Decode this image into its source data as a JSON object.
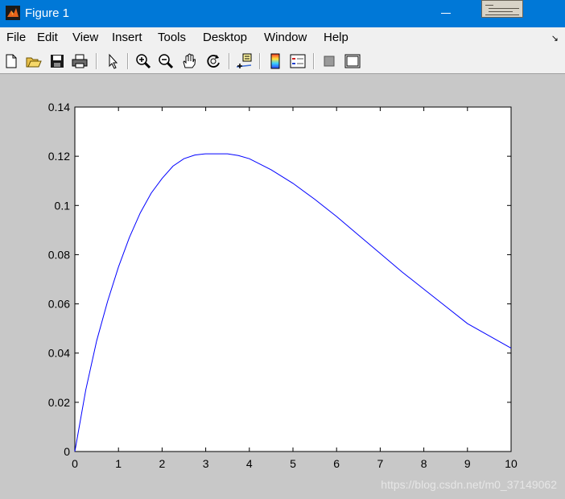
{
  "window": {
    "title": "Figure 1"
  },
  "menu": {
    "file": "File",
    "edit": "Edit",
    "view": "View",
    "insert": "Insert",
    "tools": "Tools",
    "desktop": "Desktop",
    "window": "Window",
    "help": "Help"
  },
  "toolbar": {
    "buttons": [
      "new-figure-icon",
      "open-file-icon",
      "save-icon",
      "print-icon",
      "edit-plot-icon",
      "zoom-in-icon",
      "zoom-out-icon",
      "pan-icon",
      "rotate-3d-icon",
      "data-cursor-icon",
      "colorbar-icon",
      "legend-icon",
      "hide-plot-tools-icon",
      "show-plot-tools-icon"
    ]
  },
  "watermark": "https://blog.csdn.net/m0_37149062",
  "chart_data": {
    "type": "line",
    "x": [
      0,
      0.25,
      0.5,
      0.75,
      1,
      1.25,
      1.5,
      1.75,
      2,
      2.25,
      2.5,
      2.75,
      3,
      3.25,
      3.5,
      3.75,
      4,
      4.5,
      5,
      5.5,
      6,
      6.5,
      7,
      7.5,
      8,
      8.5,
      9,
      9.5,
      10
    ],
    "series": [
      {
        "values": [
          0,
          0.025,
          0.045,
          0.061,
          0.075,
          0.087,
          0.097,
          0.105,
          0.111,
          0.116,
          0.119,
          0.1205,
          0.121,
          0.121,
          0.121,
          0.1203,
          0.119,
          0.1145,
          0.109,
          0.1025,
          0.0955,
          0.088,
          0.0805,
          0.073,
          0.066,
          0.059,
          0.052,
          0.047,
          0.042
        ]
      }
    ],
    "xlim": [
      0,
      10
    ],
    "ylim": [
      0,
      0.14
    ],
    "xticks": [
      0,
      1,
      2,
      3,
      4,
      5,
      6,
      7,
      8,
      9,
      10
    ],
    "xtick_labels": [
      "0",
      "1",
      "2",
      "3",
      "4",
      "5",
      "6",
      "7",
      "8",
      "9",
      "10"
    ],
    "yticks": [
      0,
      0.02,
      0.04,
      0.06,
      0.08,
      0.1,
      0.12,
      0.14
    ],
    "ytick_labels": [
      "0",
      "0.02",
      "0.04",
      "0.06",
      "0.08",
      "0.1",
      "0.12",
      "0.14"
    ],
    "grid": false,
    "line_color": "#0000ff"
  }
}
